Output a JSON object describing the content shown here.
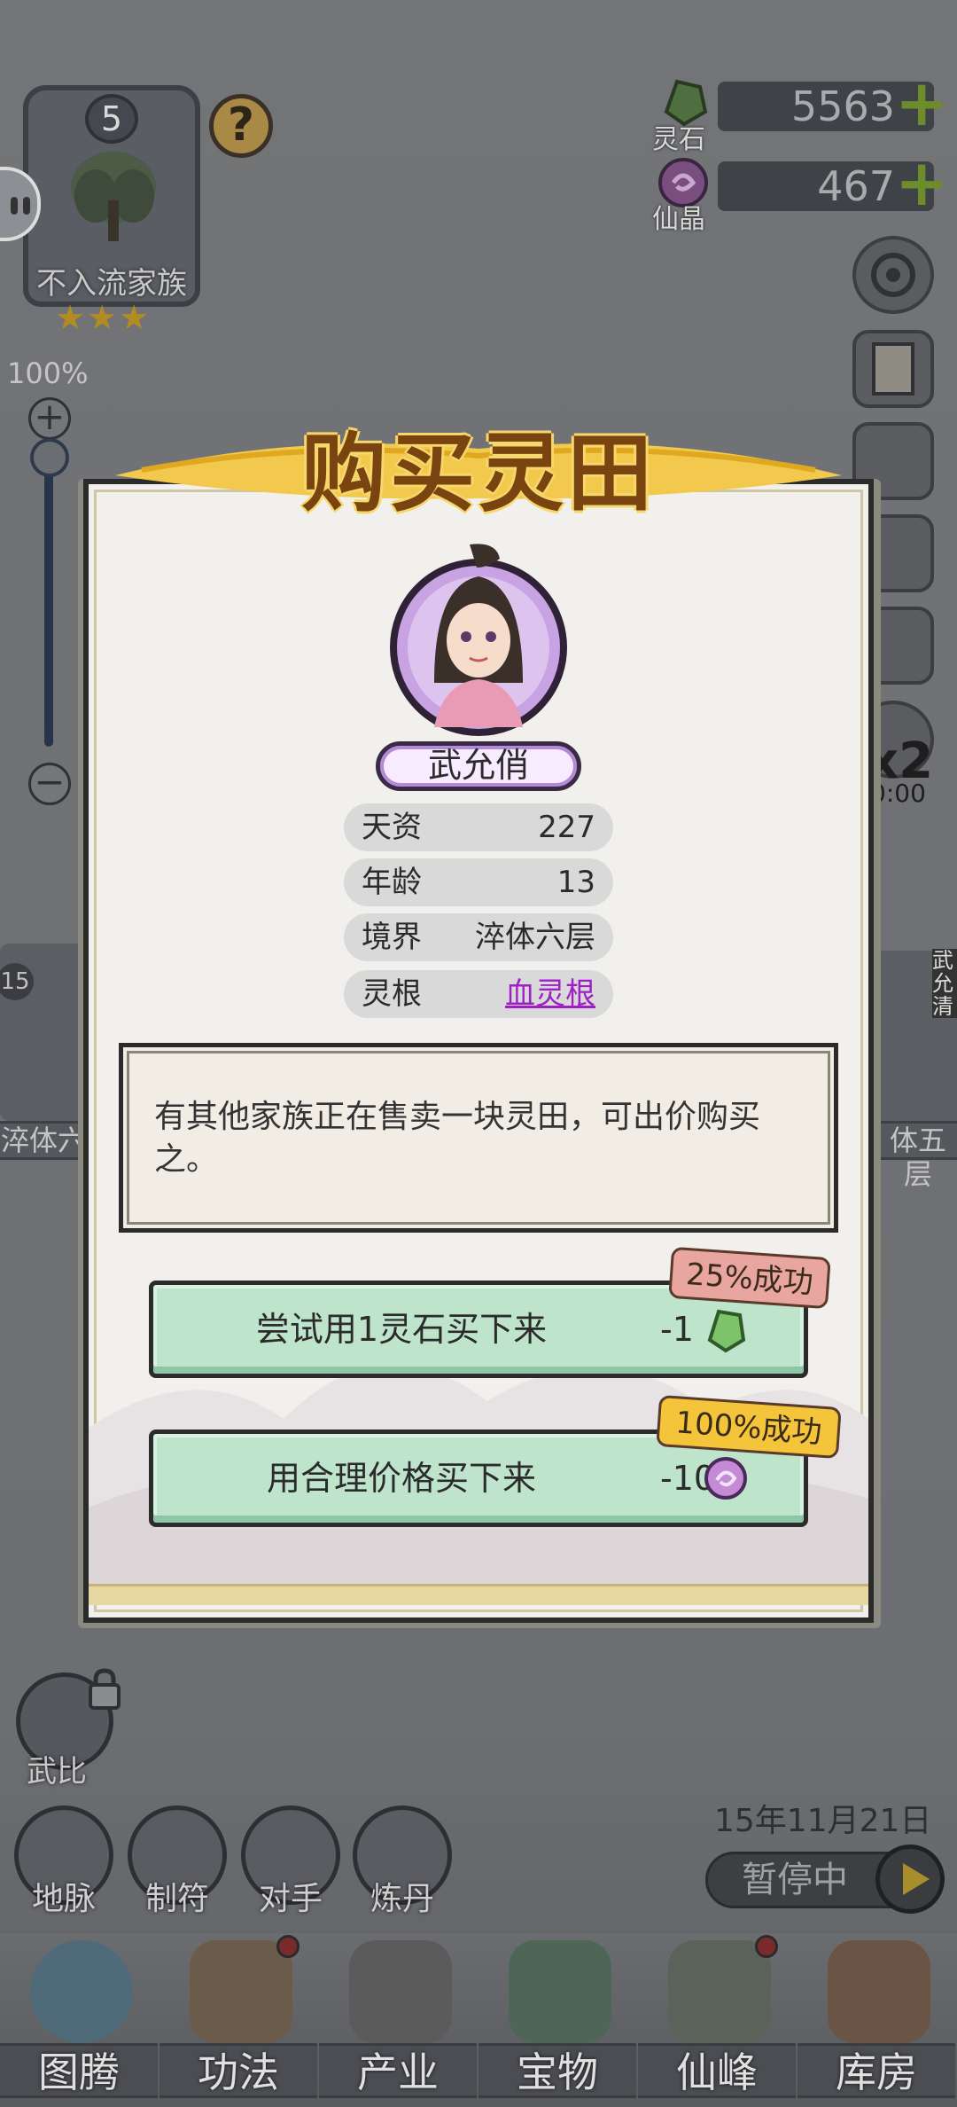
{
  "family": {
    "level": "5",
    "name": "不入流家族",
    "stars": "★★★",
    "help_icon": "?"
  },
  "currencies": [
    {
      "label": "灵石",
      "value": "5563",
      "icon": "spirit-stone-icon",
      "color": "#4e6f3f"
    },
    {
      "label": "仙晶",
      "value": "467",
      "icon": "immortal-crystal-icon",
      "color": "#7a4f7f"
    }
  ],
  "zoom": {
    "percent": "100%",
    "plus": "+",
    "minus": "−"
  },
  "speed": {
    "multiplier": "x2",
    "timer": "0:00"
  },
  "side_cards": {
    "left_badge": "15",
    "left_label": "淬体六",
    "right_label": "体五层",
    "right_name": "武允清"
  },
  "modal": {
    "title": "购买灵田",
    "disciple_name": "武允俏",
    "stats": [
      {
        "label": "天资",
        "value": "227"
      },
      {
        "label": "年龄",
        "value": "13"
      },
      {
        "label": "境界",
        "value": "淬体六层"
      },
      {
        "label": "灵根",
        "value": "血灵根"
      }
    ],
    "description": "有其他家族正在售卖一块灵田，可出价购买之。",
    "options": [
      {
        "label": "尝试用1灵石买下来",
        "cost": "-1",
        "cost_icon": "spirit-stone-icon",
        "chance": "25%成功"
      },
      {
        "label": "用合理价格买下来",
        "cost": "-10",
        "cost_icon": "immortal-crystal-icon",
        "chance": "100%成功"
      }
    ]
  },
  "battle": {
    "label": "武比"
  },
  "actions": [
    {
      "label": "地脉"
    },
    {
      "label": "制符"
    },
    {
      "label": "对手"
    },
    {
      "label": "炼丹"
    }
  ],
  "date": "15年11月21日",
  "pause_label": "暂停中",
  "nav": [
    {
      "label": "图腾"
    },
    {
      "label": "功法"
    },
    {
      "label": "产业"
    },
    {
      "label": "宝物"
    },
    {
      "label": "仙峰"
    },
    {
      "label": "库房"
    }
  ],
  "colors": {
    "overlay": "#6f7073",
    "title_text": "#7a4410",
    "title_glow": "#f5d76c",
    "button_green": "#bfe4cc",
    "chance_red": "#e9a6a0",
    "chance_gold": "#f4c43b",
    "link_purple": "#a020c8"
  }
}
